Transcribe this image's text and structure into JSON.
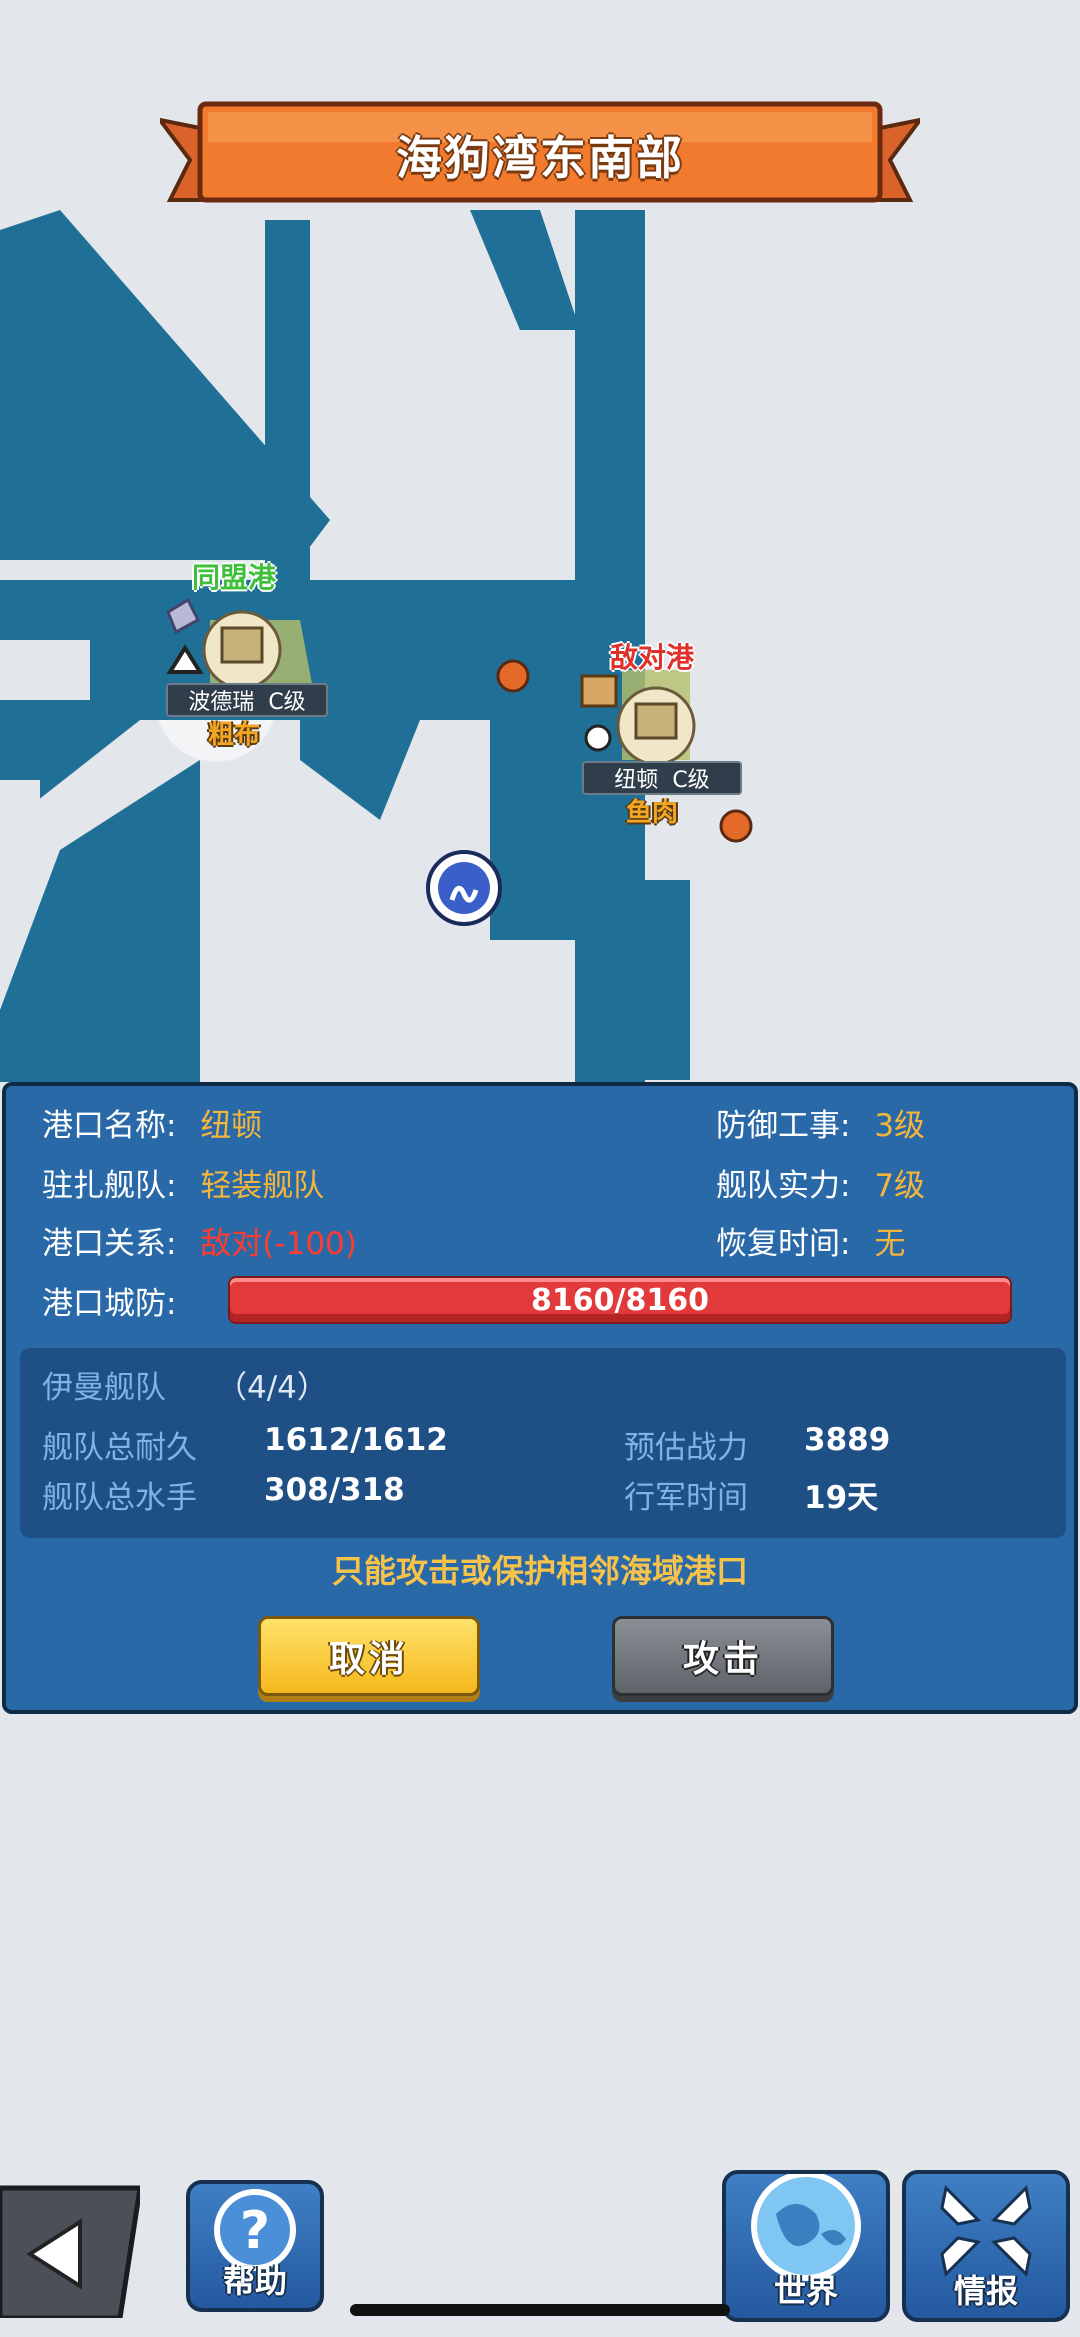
{
  "region_title": "海狗湾东南部",
  "map": {
    "ally_port": {
      "tag": "同盟港",
      "name": "波德瑞",
      "grade": "C级",
      "resource": "粗布"
    },
    "enemy_port": {
      "tag": "敌对港",
      "name": "纽顿",
      "grade": "C级",
      "resource": "鱼肉"
    }
  },
  "port_info": {
    "name_label": "港口名称:",
    "name_value": "纽顿",
    "fleet_label": "驻扎舰队:",
    "fleet_value": "轻装舰队",
    "relation_label": "港口关系:",
    "relation_value": "敌对(-100)",
    "defense_label": "港口城防:",
    "defense_value": "8160/8160",
    "fort_label": "防御工事:",
    "fort_value": "3级",
    "strength_label": "舰队实力:",
    "strength_value": "7级",
    "recover_label": "恢复时间:",
    "recover_value": "无"
  },
  "player_fleet": {
    "name": "伊曼舰队",
    "count": "（4/4）",
    "durability_label": "舰队总耐久",
    "durability_value": "1612/1612",
    "sailors_label": "舰队总水手",
    "sailors_value": "308/318",
    "power_label": "预估战力",
    "power_value": "3889",
    "march_label": "行军时间",
    "march_value": "19天"
  },
  "notice": "只能攻击或保护相邻海域港口",
  "buttons": {
    "cancel": "取消",
    "attack": "攻击"
  },
  "bottom_nav": {
    "help": "帮助",
    "world": "世界",
    "info": "情报"
  },
  "colors": {
    "sea": "#1f6f96",
    "panel": "#2a69a8",
    "accent": "#f3b53a",
    "enemy": "#e0302a",
    "ally": "#3fbf3a"
  }
}
